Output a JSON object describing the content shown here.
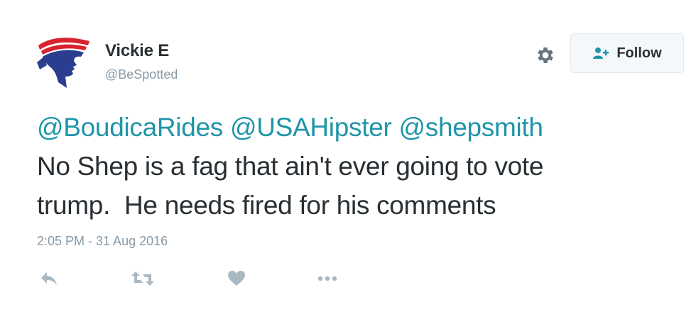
{
  "author": {
    "display_name": "Vickie E",
    "handle": "@BeSpotted",
    "avatar_icon": "flag-profile-avatar"
  },
  "header": {
    "settings_icon": "gear-icon",
    "follow_label": "Follow",
    "follow_icon": "add-user-icon"
  },
  "tweet": {
    "mentions": [
      "@BoudicaRides",
      "@USAHipster",
      "@shepsmith"
    ],
    "lines": [
      "No Shep is a fag that ain't ever going to vote",
      "trump.  He needs fired for his comments"
    ],
    "timestamp": "2:05 PM - 31 Aug 2016"
  },
  "actions": {
    "reply_icon": "reply-icon",
    "retweet_icon": "retweet-icon",
    "like_icon": "heart-icon",
    "more_icon": "more-dots-icon"
  },
  "colors": {
    "link": "#1f95a8",
    "text": "#292f33",
    "muted": "#8899a6",
    "action_icon": "#aab8c2",
    "avatar_red": "#d9232e",
    "avatar_blue": "#2b3d8f"
  }
}
